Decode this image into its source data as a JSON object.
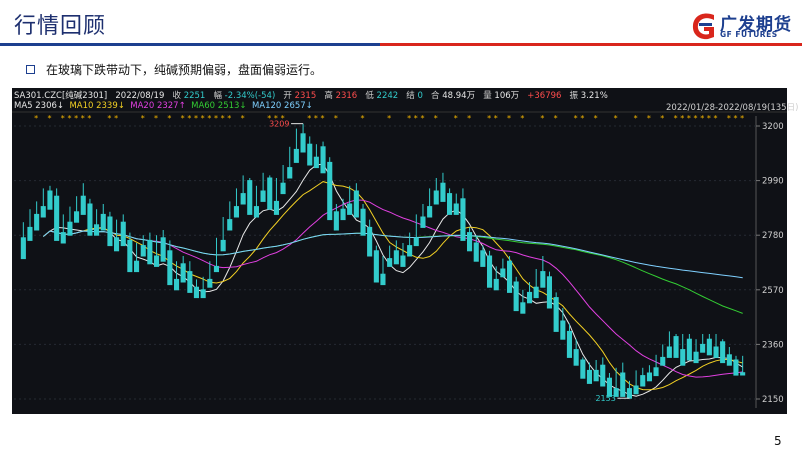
{
  "header": {
    "title": "行情回顾"
  },
  "logo": {
    "name_cn": "广发期货",
    "name_en": "GF FUTURES",
    "colors": {
      "primary": "#1d3f8f",
      "accent": "#d9261c"
    }
  },
  "bullet": {
    "text": "在玻璃下跌带动下，纯碱预期偏弱，盘面偏弱运行。"
  },
  "page": {
    "number": "5"
  },
  "quote": {
    "symbol": "SA301.CZC[纯碱2301]",
    "date": "2022/08/19",
    "close_label": "收",
    "close": "2251",
    "change_label": "幅",
    "change": "-2.34%(-54)",
    "open_label": "开",
    "open": "2315",
    "high_label": "高",
    "high": "2316",
    "low_label": "低",
    "low": "2242",
    "flat_label": "结",
    "flat": "0",
    "amount_label": "合",
    "amount": "48.94万",
    "volume_label": "量",
    "volume": "106万",
    "oi_change": "+36796",
    "amplitude_label": "振",
    "amplitude": "3.21%",
    "range": "2022/01/28-2022/08/19(135日)"
  },
  "ma_legend": [
    {
      "label": "MA5",
      "value": "2306↓",
      "color": "#e8e8e8"
    },
    {
      "label": "MA10",
      "value": "2339↓",
      "color": "#f2d024"
    },
    {
      "label": "MA20",
      "value": "2327↑",
      "color": "#e040e0"
    },
    {
      "label": "MA60",
      "value": "2513↓",
      "color": "#33cc33"
    },
    {
      "label": "MA120",
      "value": "2657↓",
      "color": "#7fd0ff"
    }
  ],
  "chart_data": {
    "type": "candlestick",
    "y_ticks": [
      "3200",
      "2990",
      "2780",
      "2570",
      "2360",
      "2150"
    ],
    "ylim": [
      2150,
      3200
    ],
    "annotations": {
      "max_label": "3209",
      "max_value": 3209,
      "min_label": "2153",
      "min_value": 2153
    },
    "colors": {
      "up": "#ff4d4d",
      "down": "#33cccc",
      "bg": "#0f1116",
      "star": "#f2b400"
    },
    "candles": [
      [
        2770,
        2830,
        2700,
        2690
      ],
      [
        2810,
        2880,
        2790,
        2760
      ],
      [
        2860,
        2910,
        2830,
        2800
      ],
      [
        2890,
        2960,
        2870,
        2850
      ],
      [
        2950,
        2970,
        2900,
        2880
      ],
      [
        2930,
        2960,
        2780,
        2760
      ],
      [
        2790,
        2860,
        2770,
        2750
      ],
      [
        2830,
        2890,
        2800,
        2780
      ],
      [
        2870,
        2930,
        2850,
        2830
      ],
      [
        2930,
        2980,
        2880,
        2860
      ],
      [
        2900,
        2920,
        2800,
        2780
      ],
      [
        2820,
        2880,
        2800,
        2780
      ],
      [
        2860,
        2900,
        2820,
        2800
      ],
      [
        2850,
        2870,
        2760,
        2740
      ],
      [
        2770,
        2840,
        2750,
        2720
      ],
      [
        2830,
        2860,
        2760,
        2740
      ],
      [
        2760,
        2790,
        2660,
        2640
      ],
      [
        2680,
        2750,
        2660,
        2640
      ],
      [
        2740,
        2780,
        2720,
        2700
      ],
      [
        2760,
        2790,
        2690,
        2670
      ],
      [
        2700,
        2780,
        2680,
        2660
      ],
      [
        2770,
        2800,
        2700,
        2680
      ],
      [
        2720,
        2760,
        2600,
        2590
      ],
      [
        2610,
        2680,
        2590,
        2570
      ],
      [
        2670,
        2700,
        2620,
        2600
      ],
      [
        2640,
        2680,
        2570,
        2560
      ],
      [
        2580,
        2610,
        2560,
        2540
      ],
      [
        2570,
        2620,
        2560,
        2540
      ],
      [
        2610,
        2680,
        2600,
        2580
      ],
      [
        2660,
        2770,
        2650,
        2640
      ],
      [
        2760,
        2850,
        2740,
        2720
      ],
      [
        2840,
        2910,
        2820,
        2800
      ],
      [
        2890,
        2960,
        2870,
        2850
      ],
      [
        2940,
        3010,
        2920,
        2900
      ],
      [
        2990,
        3000,
        2880,
        2860
      ],
      [
        2890,
        2970,
        2870,
        2850
      ],
      [
        2950,
        3020,
        2930,
        2910
      ],
      [
        3000,
        3010,
        2900,
        2880
      ],
      [
        2910,
        3000,
        2880,
        2860
      ],
      [
        2980,
        3050,
        2960,
        2940
      ],
      [
        3040,
        3120,
        3020,
        3000
      ],
      [
        3110,
        3190,
        3080,
        3060
      ],
      [
        3170,
        3209,
        3120,
        3100
      ],
      [
        3130,
        3160,
        3070,
        3050
      ],
      [
        3080,
        3130,
        3060,
        3040
      ],
      [
        3120,
        3140,
        3040,
        3020
      ],
      [
        3060,
        3080,
        2860,
        2840
      ],
      [
        2870,
        2900,
        2820,
        2800
      ],
      [
        2880,
        2920,
        2860,
        2840
      ],
      [
        2900,
        2970,
        2880,
        2860
      ],
      [
        2950,
        2980,
        2870,
        2850
      ],
      [
        2880,
        2900,
        2800,
        2780
      ],
      [
        2810,
        2840,
        2720,
        2700
      ],
      [
        2720,
        2740,
        2620,
        2600
      ],
      [
        2630,
        2700,
        2610,
        2590
      ],
      [
        2690,
        2740,
        2680,
        2660
      ],
      [
        2720,
        2760,
        2690,
        2670
      ],
      [
        2700,
        2750,
        2680,
        2660
      ],
      [
        2740,
        2790,
        2720,
        2700
      ],
      [
        2770,
        2860,
        2760,
        2740
      ],
      [
        2850,
        2900,
        2830,
        2810
      ],
      [
        2890,
        2960,
        2870,
        2850
      ],
      [
        2950,
        3000,
        2920,
        2900
      ],
      [
        2980,
        3020,
        2930,
        2910
      ],
      [
        2940,
        2960,
        2880,
        2860
      ],
      [
        2900,
        2940,
        2880,
        2860
      ],
      [
        2920,
        2960,
        2780,
        2760
      ],
      [
        2790,
        2810,
        2740,
        2720
      ],
      [
        2750,
        2780,
        2700,
        2680
      ],
      [
        2720,
        2740,
        2680,
        2660
      ],
      [
        2700,
        2720,
        2600,
        2580
      ],
      [
        2610,
        2660,
        2590,
        2570
      ],
      [
        2650,
        2690,
        2640,
        2620
      ],
      [
        2680,
        2700,
        2580,
        2560
      ],
      [
        2600,
        2620,
        2510,
        2490
      ],
      [
        2520,
        2570,
        2500,
        2480
      ],
      [
        2560,
        2600,
        2540,
        2520
      ],
      [
        2580,
        2650,
        2560,
        2540
      ],
      [
        2640,
        2700,
        2600,
        2580
      ],
      [
        2620,
        2640,
        2520,
        2500
      ],
      [
        2540,
        2560,
        2430,
        2410
      ],
      [
        2450,
        2500,
        2400,
        2380
      ],
      [
        2410,
        2440,
        2330,
        2310
      ],
      [
        2340,
        2380,
        2300,
        2280
      ],
      [
        2300,
        2310,
        2250,
        2230
      ],
      [
        2260,
        2290,
        2230,
        2210
      ],
      [
        2260,
        2300,
        2240,
        2220
      ],
      [
        2280,
        2310,
        2220,
        2200
      ],
      [
        2230,
        2250,
        2180,
        2160
      ],
      [
        2190,
        2270,
        2180,
        2160
      ],
      [
        2250,
        2290,
        2180,
        2160
      ],
      [
        2190,
        2220,
        2153,
        2153
      ],
      [
        2200,
        2260,
        2190,
        2170
      ],
      [
        2240,
        2270,
        2220,
        2200
      ],
      [
        2250,
        2280,
        2240,
        2220
      ],
      [
        2270,
        2320,
        2260,
        2240
      ],
      [
        2310,
        2360,
        2300,
        2280
      ],
      [
        2350,
        2410,
        2330,
        2310
      ],
      [
        2390,
        2400,
        2330,
        2310
      ],
      [
        2340,
        2400,
        2300,
        2280
      ],
      [
        2380,
        2400,
        2320,
        2300
      ],
      [
        2330,
        2380,
        2310,
        2290
      ],
      [
        2360,
        2400,
        2350,
        2330
      ],
      [
        2380,
        2400,
        2340,
        2320
      ],
      [
        2350,
        2400,
        2330,
        2310
      ],
      [
        2370,
        2380,
        2310,
        2290
      ],
      [
        2320,
        2350,
        2300,
        2280
      ],
      [
        2300,
        2316,
        2242,
        2242
      ],
      [
        2251,
        2316,
        2242,
        2242
      ]
    ]
  }
}
